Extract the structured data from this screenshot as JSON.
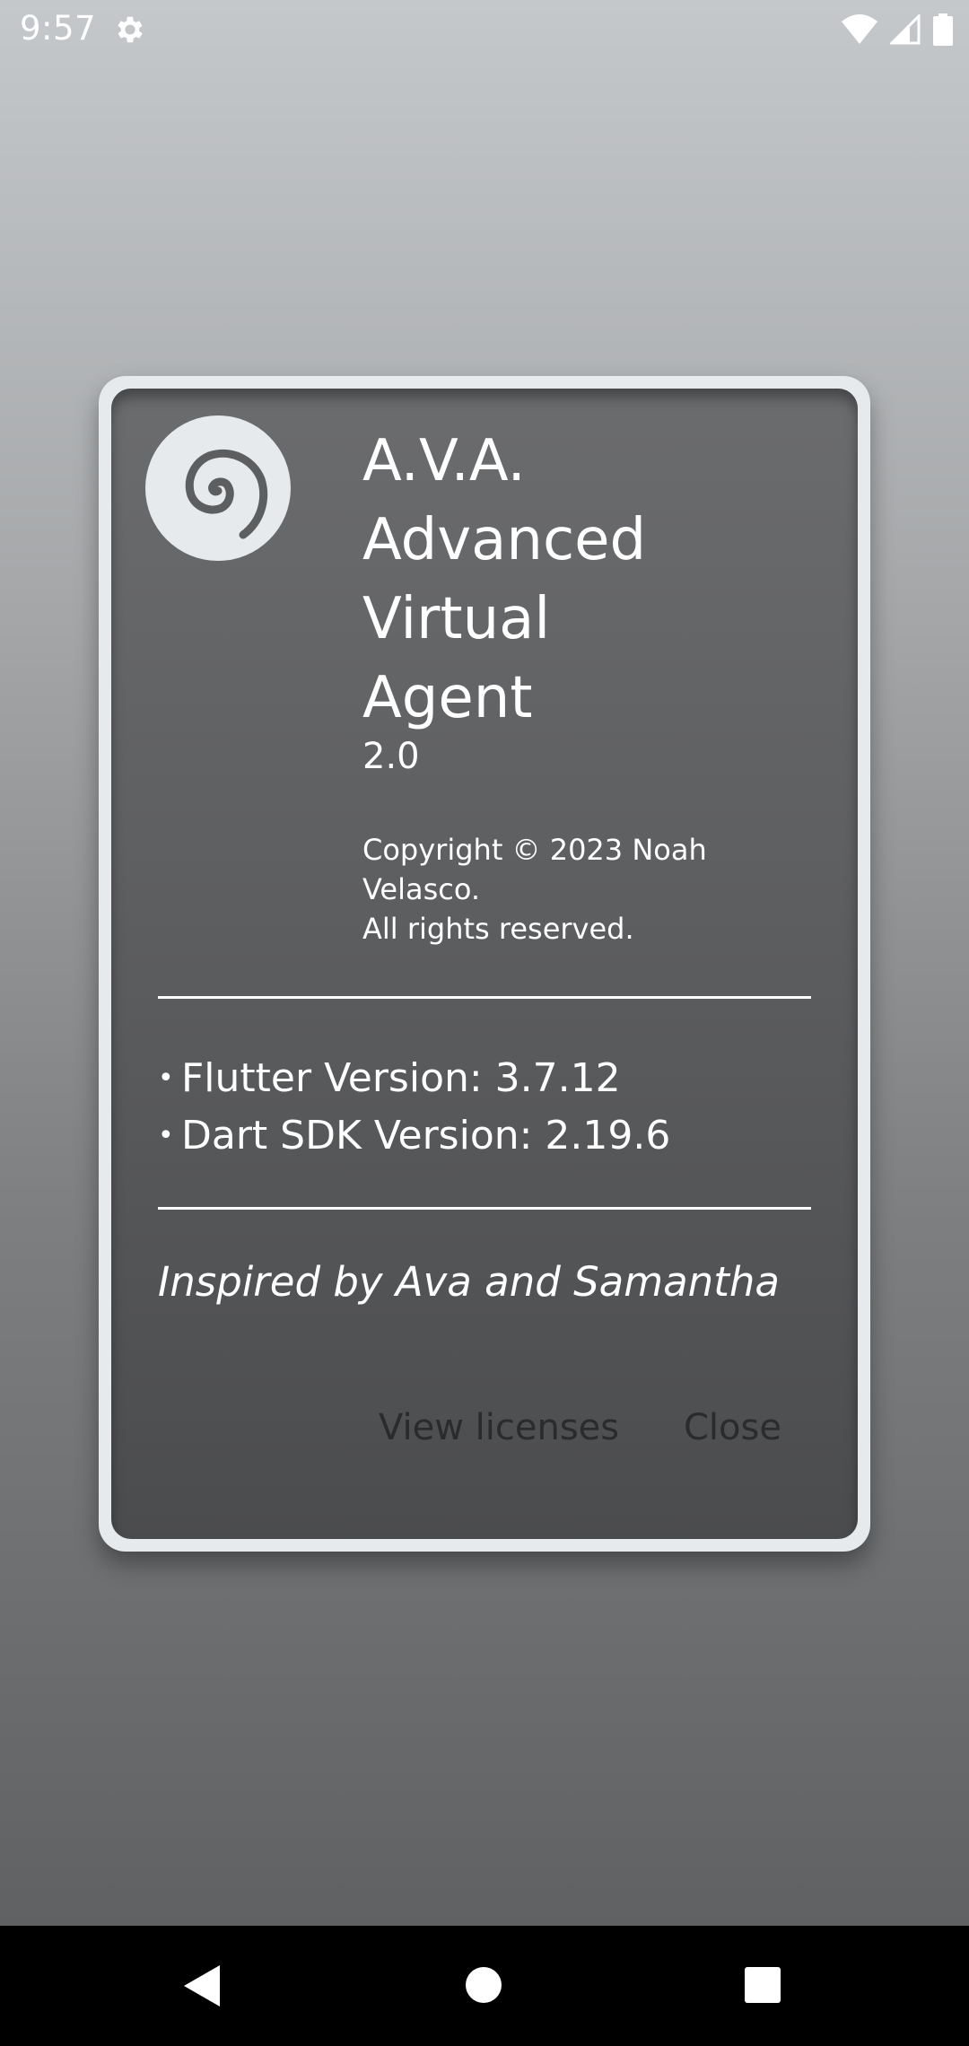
{
  "status_bar": {
    "time": "9:57",
    "icons": [
      "gear-icon",
      "wifi-icon",
      "cell-signal-icon",
      "battery-icon"
    ]
  },
  "dialog": {
    "app_name": "A.V.A.\nAdvanced\nVirtual\nAgent",
    "version": "2.0",
    "copyright": "Copyright © 2023 Noah\nVelasco.\nAll rights reserved.",
    "info_items": [
      {
        "bullet": "•",
        "text": "Flutter Version: 3.7.12"
      },
      {
        "bullet": "•",
        "text": "Dart SDK Version: 2.19.6"
      }
    ],
    "inspired": "Inspired by Ava and Samantha",
    "actions": {
      "view_licenses": "View licenses",
      "close": "Close"
    },
    "logo_icon": "spiral-logo-icon"
  },
  "nav_bar": {
    "buttons": [
      "back-icon",
      "home-icon",
      "recents-icon"
    ]
  },
  "colors": {
    "dialog_border": "#e6eaec",
    "dialog_bg": "#5d5e60",
    "text": "#ffffff",
    "button_text": "#2a2b2c",
    "nav_bg": "#000000"
  }
}
